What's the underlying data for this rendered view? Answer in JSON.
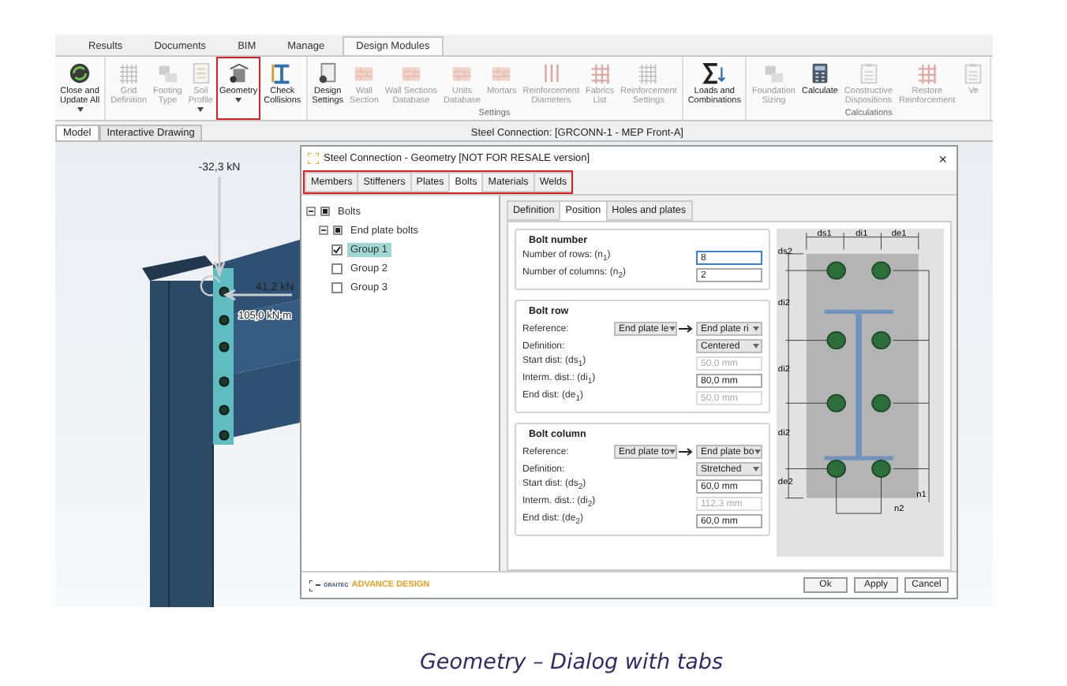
{
  "ribbon_tabs": [
    {
      "label": "Results",
      "selected": false
    },
    {
      "label": "Documents",
      "selected": false
    },
    {
      "label": "BIM",
      "selected": false
    },
    {
      "label": "Manage",
      "selected": false
    },
    {
      "label": "Design Modules",
      "selected": true
    }
  ],
  "ribbon_groups": [
    {
      "items": [
        {
          "lines": [
            "Close and",
            "Update All"
          ],
          "disabled": false,
          "dropdown": true,
          "highlighted": false
        }
      ]
    },
    {
      "items": [
        {
          "lines": [
            "Grid",
            "Definition"
          ],
          "disabled": true,
          "dropdown": false,
          "highlighted": false
        },
        {
          "lines": [
            "Footing",
            "Type"
          ],
          "disabled": true,
          "dropdown": false,
          "highlighted": false
        },
        {
          "lines": [
            "Soil",
            "Profile"
          ],
          "disabled": true,
          "dropdown": true,
          "highlighted": false
        },
        {
          "lines": [
            "Geometry"
          ],
          "disabled": false,
          "dropdown": true,
          "highlighted": true
        },
        {
          "lines": [
            "Check",
            "Collisions"
          ],
          "disabled": false,
          "dropdown": false,
          "highlighted": false
        }
      ]
    },
    {
      "label": "Settings",
      "items": [
        {
          "lines": [
            "Design",
            "Settings"
          ],
          "disabled": false,
          "dropdown": false,
          "highlighted": false
        },
        {
          "lines": [
            "Wall",
            "Section"
          ],
          "disabled": true,
          "dropdown": false,
          "highlighted": false
        },
        {
          "lines": [
            "Wall Sections",
            "Database"
          ],
          "disabled": true,
          "dropdown": false,
          "highlighted": false
        },
        {
          "lines": [
            "Units",
            "Database"
          ],
          "disabled": true,
          "dropdown": false,
          "highlighted": false
        },
        {
          "lines": [
            "Mortars"
          ],
          "disabled": true,
          "dropdown": false,
          "highlighted": false
        },
        {
          "lines": [
            "Reinforcement",
            "Diameters"
          ],
          "disabled": true,
          "dropdown": false,
          "highlighted": false
        },
        {
          "lines": [
            "Fabrics",
            "List"
          ],
          "disabled": true,
          "dropdown": false,
          "highlighted": false
        },
        {
          "lines": [
            "Reinforcement",
            "Settings"
          ],
          "disabled": true,
          "dropdown": false,
          "highlighted": false
        }
      ]
    },
    {
      "items": [
        {
          "lines": [
            "Loads and",
            "Combinations"
          ],
          "disabled": false,
          "dropdown": false,
          "highlighted": false
        }
      ]
    },
    {
      "label": "Calculations",
      "items": [
        {
          "lines": [
            "Foundation",
            "Sizing"
          ],
          "disabled": true,
          "dropdown": false,
          "highlighted": false
        },
        {
          "lines": [
            "Calculate"
          ],
          "disabled": false,
          "dropdown": false,
          "highlighted": false
        },
        {
          "lines": [
            "Constructive",
            "Dispositions"
          ],
          "disabled": true,
          "dropdown": false,
          "highlighted": false
        },
        {
          "lines": [
            "Restore",
            "Reinforcement"
          ],
          "disabled": true,
          "dropdown": false,
          "highlighted": false
        },
        {
          "lines": [
            "Ve"
          ],
          "disabled": true,
          "dropdown": false,
          "highlighted": false
        }
      ]
    }
  ],
  "view_tabs": [
    {
      "label": "Model",
      "selected": true
    },
    {
      "label": "Interactive Drawing",
      "selected": false
    }
  ],
  "view_title": "Steel Connection: [GRCONN-1 - MEP Front-A]",
  "model_view": {
    "axial_load": "-32,3 kN",
    "shear_load": "41,2 kN",
    "moment": "105,0 kN·m"
  },
  "dialog": {
    "title": "Steel Connection - Geometry [NOT FOR RESALE version]",
    "tabs": [
      {
        "label": "Members",
        "selected": false
      },
      {
        "label": "Stiffeners",
        "selected": false
      },
      {
        "label": "Plates",
        "selected": false
      },
      {
        "label": "Bolts",
        "selected": true
      },
      {
        "label": "Materials",
        "selected": false
      },
      {
        "label": "Welds",
        "selected": false
      }
    ],
    "tree": [
      {
        "label": "Bolts",
        "kind": "folder",
        "expanded": true,
        "checked": true,
        "children": [
          {
            "label": "End plate bolts",
            "kind": "folder",
            "expanded": true,
            "checked": true,
            "children": [
              {
                "label": "Group 1",
                "kind": "leaf",
                "checked": true,
                "selected": true
              },
              {
                "label": "Group 2",
                "kind": "leaf",
                "checked": false,
                "selected": false
              },
              {
                "label": "Group 3",
                "kind": "leaf",
                "checked": false,
                "selected": false
              }
            ]
          }
        ]
      }
    ],
    "sub_tabs": [
      {
        "label": "Definition",
        "selected": false
      },
      {
        "label": "Position",
        "selected": true
      },
      {
        "label": "Holes and plates",
        "selected": false
      }
    ],
    "sections": [
      {
        "title": "Bolt number",
        "rows": [
          {
            "kind": "input",
            "label": "Number of rows: (n$_{1}$)",
            "value": "8",
            "disabled": false,
            "focused": true
          },
          {
            "kind": "input",
            "label": "Number of columns: (n$_{2}$)",
            "value": "2",
            "disabled": false,
            "focused": false
          }
        ]
      },
      {
        "title": "Bolt row",
        "rows": [
          {
            "kind": "reference",
            "label": "Reference:",
            "from": "End plate le",
            "to": "End plate ri"
          },
          {
            "kind": "select",
            "label": "Definition:",
            "value": "Centered"
          },
          {
            "kind": "input",
            "label": "Start dist: (ds$_{1}$)",
            "value": "50,0 mm",
            "disabled": true,
            "focused": false
          },
          {
            "kind": "input",
            "label": "Interm. dist.: (di$_{1}$)",
            "value": "80,0 mm",
            "disabled": false,
            "focused": false
          },
          {
            "kind": "input",
            "label": "End dist: (de$_{1}$)",
            "value": "50,0 mm",
            "disabled": true,
            "focused": false
          }
        ]
      },
      {
        "title": "Bolt column",
        "rows": [
          {
            "kind": "reference",
            "label": "Reference:",
            "from": "End plate to",
            "to": "End plate bo"
          },
          {
            "kind": "select",
            "label": "Definition:",
            "value": "Stretched"
          },
          {
            "kind": "input",
            "label": "Start dist: (ds$_{2}$)",
            "value": "60,0 mm",
            "disabled": false,
            "focused": false
          },
          {
            "kind": "input",
            "label": "Interm. dist.: (di$_{2}$)",
            "value": "112,3 mm",
            "disabled": true,
            "focused": false
          },
          {
            "kind": "input",
            "label": "End dist: (de$_{2}$)",
            "value": "60,0 mm",
            "disabled": false,
            "focused": false
          }
        ]
      }
    ],
    "close_label": "×",
    "diagram": {
      "top_labels": [
        "ds1",
        "di1",
        "de1"
      ],
      "left_labels": [
        "ds2",
        "di2",
        "di2",
        "di2",
        "de2"
      ],
      "row_count_label": "n1",
      "column_count_label": "n2"
    },
    "logo": {
      "brand": "GRAITEC",
      "product": "ADVANCE DESIGN"
    },
    "buttons": [
      "Ok",
      "Apply",
      "Cancel"
    ]
  },
  "caption": "Geometry – Dialog with tabs"
}
